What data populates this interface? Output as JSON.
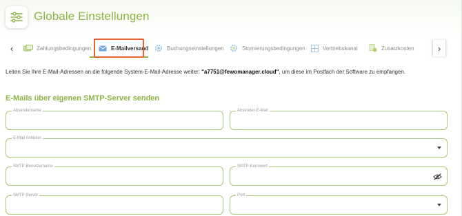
{
  "header": {
    "title": "Globale Einstellungen",
    "icon": "sliders-icon",
    "accent_color": "#8cb442"
  },
  "tabs": {
    "prev_arrow": "‹",
    "next_arrow": "›",
    "items": [
      {
        "label": "Zahlungsbedingungen",
        "icon": "payment-icon"
      },
      {
        "label": "E-Mailversand",
        "icon": "mail-icon",
        "active": true
      },
      {
        "label": "Buchungseinstellungen",
        "icon": "gear-icon"
      },
      {
        "label": "Stornierungsbedingungen",
        "icon": "gear-cancel-icon"
      },
      {
        "label": "Vertriebskanal",
        "icon": "grid-icon"
      },
      {
        "label": "Zusatzkosten",
        "icon": "receipt-icon"
      }
    ],
    "highlight_color": "#e8612c"
  },
  "info": {
    "prefix": "Leiten Sie Ihre E-Mail-Adressen an die folgende System-E-Mail-Adresse weiter: ",
    "address": "\"a7751@fewomanager.cloud\"",
    "suffix": ", um diese im Postfach der Software zu empfangen."
  },
  "smtp": {
    "section_title": "E-Mails über eigenen SMTP-Server senden",
    "fields": {
      "sender_name": {
        "label": "Absendername",
        "value": ""
      },
      "sender_email": {
        "label": "Absender-E-Mail",
        "value": ""
      },
      "provider": {
        "label": "E-Mail Anbieter",
        "value": ""
      },
      "username": {
        "label": "SMTP-Benutzername",
        "value": ""
      },
      "password": {
        "label": "SMTP-Kennwort",
        "value": ""
      },
      "server": {
        "label": "SMTP-Server",
        "value": ""
      },
      "port": {
        "label": "Port",
        "value": ""
      }
    }
  }
}
